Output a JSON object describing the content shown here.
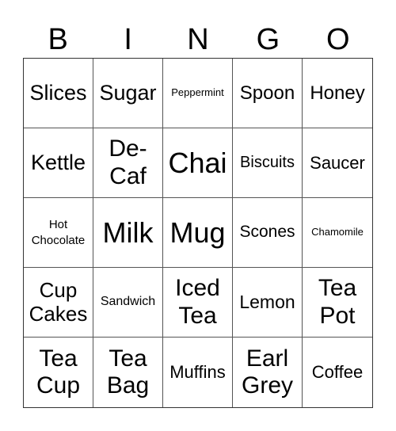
{
  "header": [
    "B",
    "I",
    "N",
    "G",
    "O"
  ],
  "cells": [
    "Slices",
    "Sugar",
    "Peppermint",
    "Spoon",
    "Honey",
    "Kettle",
    "De-Caf",
    "Chai",
    "Biscuits",
    "Saucer",
    "Hot Chocolate",
    "Milk",
    "Mug",
    "Scones",
    "Chamomile",
    "Cup Cakes",
    "Sandwich",
    "Iced Tea",
    "Lemon",
    "Tea Pot",
    "Tea Cup",
    "Tea Bag",
    "Muffins",
    "Earl Grey",
    "Coffee"
  ]
}
